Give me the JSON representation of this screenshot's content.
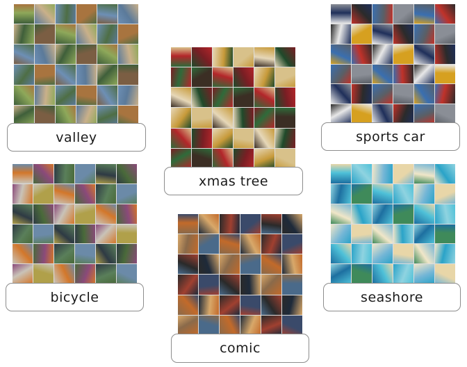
{
  "categories": [
    {
      "id": "valley",
      "label": "valley",
      "palette": [
        "#5b7a9a",
        "#8ea85a",
        "#a8743f",
        "#3f5f3a",
        "#c9b08a",
        "#6d8fb5",
        "#7b5e43",
        "#4e6e45"
      ]
    },
    {
      "id": "sports-car",
      "label": "sports car",
      "palette": [
        "#c0322a",
        "#1f2f5a",
        "#8a8e96",
        "#e8e8e8",
        "#2b2b2b",
        "#3a6fb0",
        "#d6a020",
        "#5a5f66"
      ]
    },
    {
      "id": "xmas-tree",
      "label": "xmas tree",
      "palette": [
        "#1f4a2a",
        "#b3262a",
        "#d8c18a",
        "#2f6b3a",
        "#7a1e24",
        "#e6d7b8",
        "#3b2e24",
        "#c79a3a"
      ]
    },
    {
      "id": "bicycle",
      "label": "bicycle",
      "palette": [
        "#4a6a3a",
        "#d3772a",
        "#6b8aa8",
        "#c9c3b8",
        "#8a4a7a",
        "#2e3a44",
        "#b0a04a",
        "#5a7f5a"
      ]
    },
    {
      "id": "seashore",
      "label": "seashore",
      "palette": [
        "#2aa3c8",
        "#4fc1d8",
        "#e8d6a8",
        "#1d6fa0",
        "#8fd3e0",
        "#f0e6c8",
        "#3f8a5a",
        "#74b6d6"
      ]
    },
    {
      "id": "comic",
      "label": "comic",
      "palette": [
        "#1e2a3a",
        "#c26a2a",
        "#3a4a6a",
        "#8a6a4a",
        "#d8a86a",
        "#2a2a2a",
        "#4a6a8a",
        "#a04030"
      ]
    }
  ]
}
